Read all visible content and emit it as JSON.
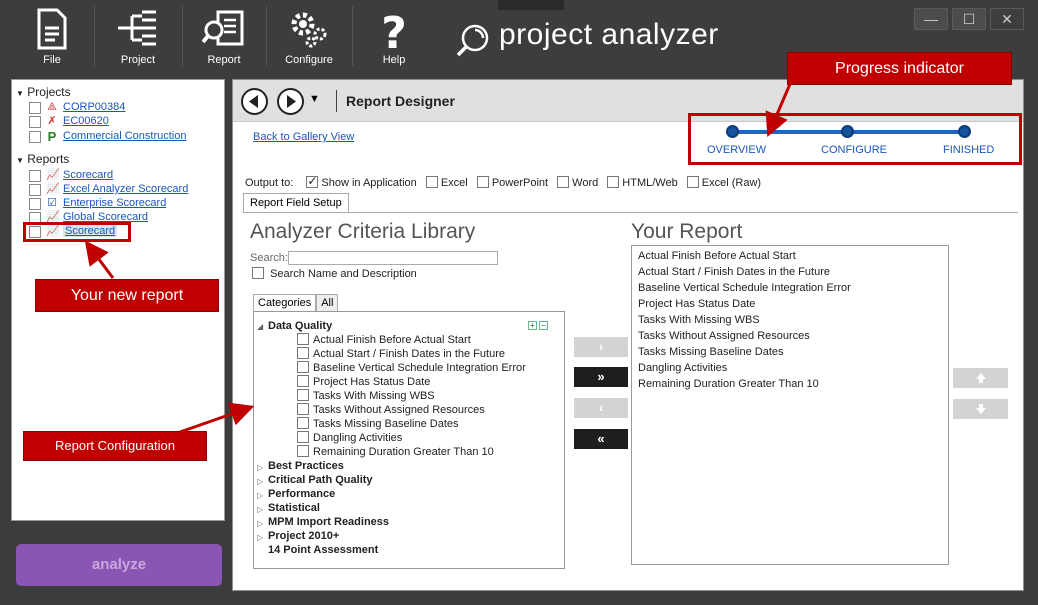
{
  "toolbar": {
    "file": "File",
    "project": "Project",
    "report": "Report",
    "configure": "Configure",
    "help": "Help"
  },
  "app": {
    "name": "project analyzer"
  },
  "window": {
    "minimize": "—",
    "maximize": "☐",
    "close": "✕"
  },
  "sidebar": {
    "projects_header": "Projects",
    "projects": [
      "CORP00384",
      "EC00620",
      "Commercial Construction"
    ],
    "reports_header": "Reports",
    "reports": [
      "Scorecard",
      "Excel Analyzer Scorecard",
      "Enterprise Scorecard",
      "Global Scorecard",
      "Scorecard"
    ],
    "analyze": "analyze"
  },
  "designer": {
    "title": "Report Designer",
    "back_link": "Back to Gallery View",
    "steps": [
      "OVERVIEW",
      "CONFIGURE",
      "FINISHED"
    ],
    "output_label": "Output to:",
    "outputs": [
      {
        "label": "Show in Application",
        "checked": true
      },
      {
        "label": "Excel",
        "checked": false
      },
      {
        "label": "PowerPoint",
        "checked": false
      },
      {
        "label": "Word",
        "checked": false
      },
      {
        "label": "HTML/Web",
        "checked": false
      },
      {
        "label": "Excel (Raw)",
        "checked": false
      }
    ],
    "tab": "Report Field Setup",
    "library_title": "Analyzer Criteria Library",
    "search_label": "Search:",
    "search_value": "",
    "search_name_desc": "Search Name and Description",
    "cat_tabs": [
      "Categories",
      "All"
    ],
    "data_quality": "Data Quality",
    "dq_items": [
      "Actual Finish Before Actual Start",
      "Actual Start / Finish Dates in the Future",
      "Baseline Vertical Schedule Integration Error",
      "Project Has Status Date",
      "Tasks With Missing WBS",
      "Tasks Without Assigned Resources",
      "Tasks Missing Baseline Dates",
      "Dangling Activities",
      "Remaining Duration Greater Than 10"
    ],
    "groups": [
      "Best Practices",
      "Critical Path Quality",
      "Performance",
      "Statistical",
      "MPM Import Readiness",
      "Project 2010+",
      "14 Point Assessment"
    ],
    "report_title": "Your Report",
    "report_items": [
      "Actual Finish Before Actual Start",
      "Actual Start / Finish Dates in the Future",
      "Baseline Vertical Schedule Integration Error",
      "Project Has Status Date",
      "Tasks With Missing WBS",
      "Tasks Without Assigned Resources",
      "Tasks Missing Baseline Dates",
      "Dangling Activities",
      "Remaining Duration Greater Than 10"
    ]
  },
  "annotations": {
    "progress": "Progress indicator",
    "new_report": "Your new report",
    "config": "Report Configuration"
  },
  "colors": {
    "accent_red": "#c00000",
    "analyze_purple": "#8a55b3",
    "step_blue": "#1e66c1"
  }
}
